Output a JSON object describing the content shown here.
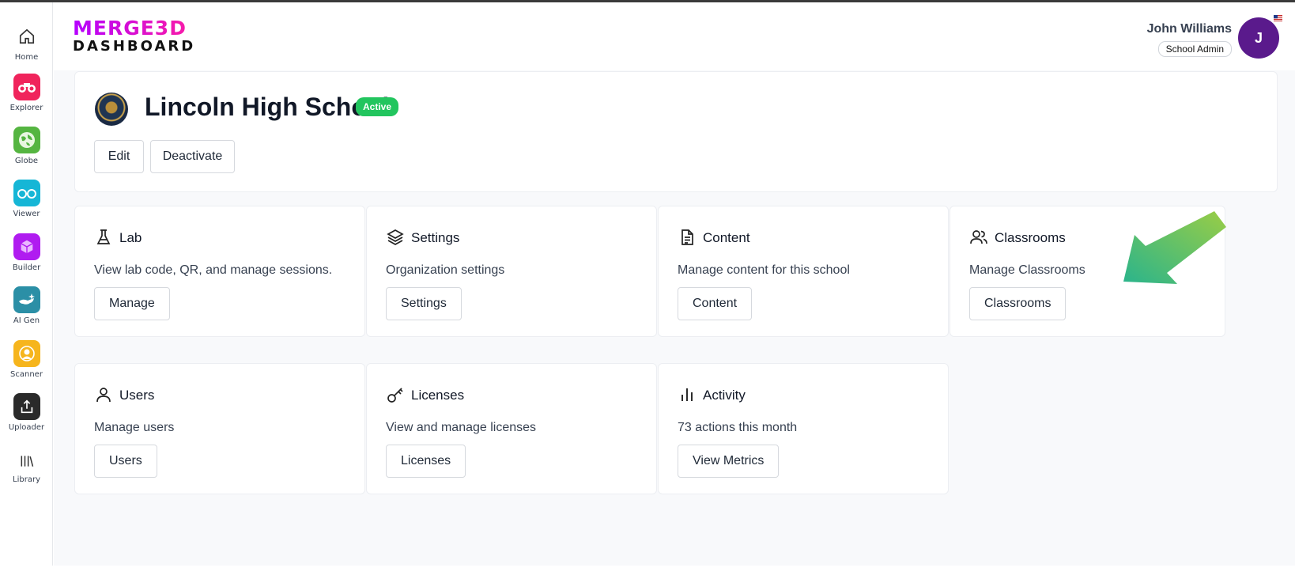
{
  "sidebar": {
    "items": [
      {
        "label": "Home",
        "icon": "home-icon"
      },
      {
        "label": "Explorer",
        "icon": "binoculars-icon",
        "color": "#f0245c"
      },
      {
        "label": "Globe",
        "icon": "globe-icon",
        "color": "#55b541"
      },
      {
        "label": "Viewer",
        "icon": "glasses-icon",
        "color": "#16b6d6"
      },
      {
        "label": "Builder",
        "icon": "cube-icon",
        "color": "#b01cf0"
      },
      {
        "label": "AI Gen",
        "icon": "genie-lamp-icon",
        "color": "#2b8fa6"
      },
      {
        "label": "Scanner",
        "icon": "scanner-icon",
        "color": "#f6b51d"
      },
      {
        "label": "Uploader",
        "icon": "upload-icon",
        "color": "#2a2a2a"
      },
      {
        "label": "Library",
        "icon": "library-icon"
      }
    ]
  },
  "header": {
    "logo_top": "MERGE3D",
    "logo_bottom": "DASHBOARD",
    "user_name": "John Williams",
    "user_role": "School Admin",
    "avatar_initial": "J",
    "avatar_color": "#5a1a8c"
  },
  "school": {
    "name": "Lincoln High School",
    "status": "Active",
    "status_color": "#22c55e",
    "edit_label": "Edit",
    "deactivate_label": "Deactivate"
  },
  "cards": [
    {
      "title": "Lab",
      "icon": "flask-icon",
      "description": "View lab code, QR, and manage sessions.",
      "button": "Manage"
    },
    {
      "title": "Settings",
      "icon": "layers-icon",
      "description": "Organization settings",
      "button": "Settings"
    },
    {
      "title": "Content",
      "icon": "document-icon",
      "description": "Manage content for this school",
      "button": "Content"
    },
    {
      "title": "Classrooms",
      "icon": "users-icon",
      "description": "Manage Classrooms",
      "button": "Classrooms"
    },
    {
      "title": "Users",
      "icon": "user-icon",
      "description": "Manage users",
      "button": "Users"
    },
    {
      "title": "Licenses",
      "icon": "key-icon",
      "description": "View and manage licenses",
      "button": "Licenses"
    },
    {
      "title": "Activity",
      "icon": "bar-chart-icon",
      "description": "73 actions this month",
      "button": "View Metrics"
    }
  ]
}
